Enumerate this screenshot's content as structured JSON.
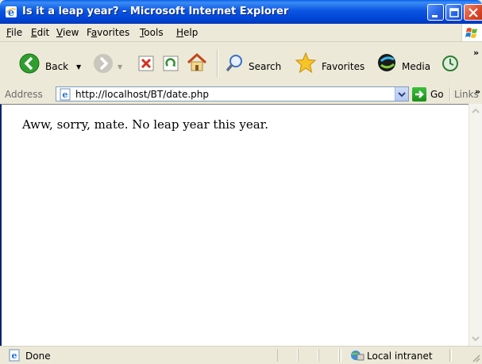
{
  "window": {
    "title": "Is it a leap year? - Microsoft Internet Explorer"
  },
  "menu": {
    "items": [
      {
        "label": "File",
        "mnemonic": "F"
      },
      {
        "label": "Edit",
        "mnemonic": "E"
      },
      {
        "label": "View",
        "mnemonic": "V"
      },
      {
        "label": "Favorites",
        "mnemonic": "a"
      },
      {
        "label": "Tools",
        "mnemonic": "T"
      },
      {
        "label": "Help",
        "mnemonic": "H"
      }
    ]
  },
  "toolbar": {
    "back_label": "Back",
    "search_label": "Search",
    "favorites_label": "Favorites",
    "media_label": "Media"
  },
  "address": {
    "label": "Address",
    "url": "http://localhost/BT/date.php",
    "go_label": "Go",
    "links_label": "Links"
  },
  "page": {
    "message": "Aww, sorry, mate. No leap year this year."
  },
  "status": {
    "text": "Done",
    "zone": "Local intranet"
  },
  "colors": {
    "titlebar": "#0054e3",
    "chrome": "#ece9d8",
    "close_button": "#d9482a"
  }
}
